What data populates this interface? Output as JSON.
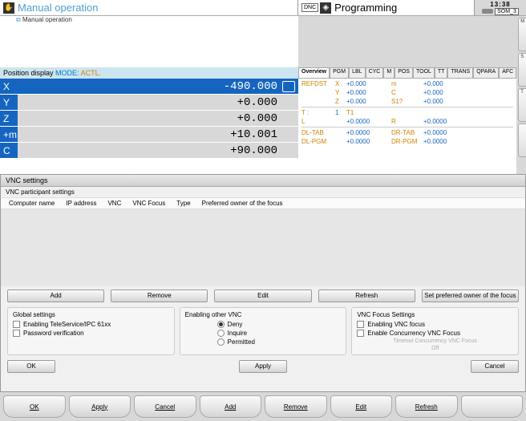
{
  "header": {
    "mode_title": "Manual operation",
    "sub_line": "Manual operation",
    "dnc": "DNC",
    "prog_title": "Programming",
    "clock": "13:38",
    "som": "SOM_3"
  },
  "pos_display": {
    "prefix": "Position display ",
    "mode_label": "MODE: ",
    "mode_value": "ACTL."
  },
  "axes": [
    {
      "label": "X",
      "value": "-490.000",
      "active": true
    },
    {
      "label": "Y",
      "value": "+0.000",
      "active": false
    },
    {
      "label": "Z",
      "value": "+0.000",
      "active": false
    },
    {
      "label": "+m",
      "value": "+10.001",
      "active": false
    },
    {
      "label": "C",
      "value": "+90.000",
      "active": false
    }
  ],
  "tabs": [
    "Overview",
    "PGM",
    "LBL",
    "CYC",
    "M",
    "POS",
    "TOOL",
    "TT",
    "TRANS",
    "QPARA",
    "AFC"
  ],
  "overview_rows": [
    {
      "l1": "REFDST",
      "ax": "X",
      "v1": "+0.000",
      "l2": "m",
      "v2": "+0.000"
    },
    {
      "l1": "",
      "ax": "Y",
      "v1": "+0.000",
      "l2": "C",
      "v2": "+0.000"
    },
    {
      "l1": "",
      "ax": "Z",
      "v1": "+0.000",
      "l2": "S1?",
      "v2": "+0.000"
    }
  ],
  "overview_t": {
    "l": "T  :",
    "n": "1",
    "t": "T1"
  },
  "overview_l": {
    "l": "L",
    "v": "+0.0000",
    "l2": "R",
    "v2": "+0.0000"
  },
  "overview_dl": [
    {
      "l": "DL-TAB",
      "v": "+0.0000",
      "l2": "DR-TAB",
      "v2": "+0.0000"
    },
    {
      "l": "DL-PGM",
      "v": "+0.0000",
      "l2": "DR-PGM",
      "v2": "+0.0000"
    }
  ],
  "side_tags": [
    "M",
    "S",
    "T",
    ""
  ],
  "vnc": {
    "window_title": "VNC settings",
    "group1": "VNC participant settings",
    "headers": [
      "Computer name",
      "IP address",
      "VNC",
      "VNC Focus",
      "Type",
      "Preferred owner of the focus"
    ],
    "buttons": [
      "Add",
      "Remove",
      "Edit",
      "Refresh",
      "Set preferred owner of the focus"
    ],
    "global_title": "Global settings",
    "global_checks": [
      "Enabling TeleService/IPC 61xx",
      "Password verification"
    ],
    "other_title": "Enabling other VNC",
    "other_radios": [
      "Deny",
      "Inquire",
      "Permitted"
    ],
    "focus_title": "VNC Focus Settings",
    "focus_checks": [
      "Enabling VNC focus",
      "Enable Concurrency VNC Focus"
    ],
    "focus_timeout_label": "Timeout Concurrency VNC Focus",
    "focus_timeout_value": "Off",
    "footer": {
      "ok": "OK",
      "apply": "Apply",
      "cancel": "Cancel"
    }
  },
  "softkeys": [
    "OK",
    "Apply",
    "Cancel",
    "Add",
    "Remove",
    "Edit",
    "Refresh",
    ""
  ]
}
